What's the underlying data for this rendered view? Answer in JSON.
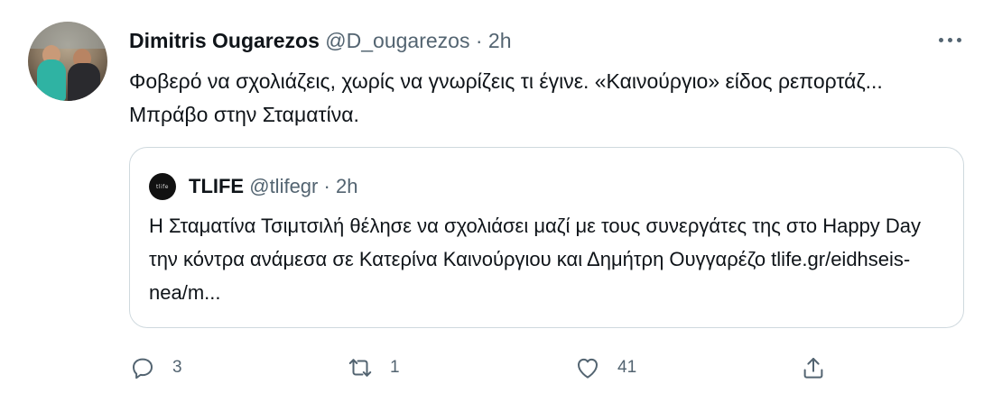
{
  "tweet": {
    "author_name": "Dimitris Ougarezos",
    "author_handle": "@D_ougarezos",
    "separator": "·",
    "time": "2h",
    "text": "Φοβερό να σχολιάζεις, χωρίς να γνωρίζεις τι έγινε. «Καινούργιο» είδος ρεπορτάζ... Μπράβο στην Σταματίνα."
  },
  "quoted": {
    "author_name": "TLIFE",
    "author_handle": "@tlifegr",
    "separator": "·",
    "time": "2h",
    "avatar_text": "tlife",
    "text": "Η Σταματίνα Τσιμτσιλή θέλησε να σχολιάσει μαζί με τους συνεργάτες της στο Happy Day την κόντρα ανάμεσα σε Κατερίνα Καινούργιου και Δημήτρη Ουγγαρέζο tlife.gr/eidhseis-nea/m..."
  },
  "actions": {
    "reply_count": "3",
    "retweet_count": "1",
    "like_count": "41"
  },
  "icons": [
    "more-icon",
    "reply-icon",
    "retweet-icon",
    "like-icon",
    "share-icon"
  ]
}
